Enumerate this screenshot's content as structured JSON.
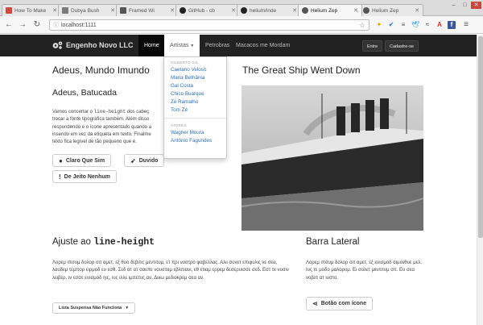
{
  "browser": {
    "tabs": [
      {
        "title": "How To Make",
        "color": "#d24a3d"
      },
      {
        "title": "Dubya Bush",
        "color": "#7b7b7b"
      },
      {
        "title": "Framed Wi",
        "color": "#555555"
      },
      {
        "title": "GitHub - cb",
        "color": "#222222"
      },
      {
        "title": "helium/inde",
        "color": "#222222"
      },
      {
        "title": "Helium Zep",
        "color": "#555555"
      },
      {
        "title": "Helium Zep",
        "color": "#555555"
      }
    ],
    "url": "localhost:1111"
  },
  "navbar": {
    "brand": "Engenho Novo LLC",
    "links": [
      "Home",
      "Artistas",
      "Petrobras",
      "Macacos me Mordam"
    ],
    "right": [
      "Entre",
      "Cadastre-se"
    ]
  },
  "dropdown": {
    "header1": "GILBERTO GIL",
    "items1": [
      "Caetano Veloso",
      "Maria Bethânia",
      "Gal Costa",
      "Chico Buarque",
      "Zé Ramalho",
      "Tom Zé"
    ],
    "header2": "ATORES",
    "items2": [
      "Wagner Moura",
      "Antônio Fagundes"
    ]
  },
  "left": {
    "title": "Adeus, Mundo Imundo",
    "subtitle": "Adeus, Batucada",
    "para": [
      {
        "t": "Vamos concertar o "
      },
      {
        "t": "line-height",
        "mono": true
      },
      {
        "t": " dos cabeç"
      },
      {
        "br": true
      },
      {
        "t": "trocar a fonte tipográfica também. Além disso"
      },
      {
        "br": true
      },
      {
        "t": "respondendo e o ícone apresentado quando a"
      },
      {
        "br": true
      },
      {
        "t": "inserido em vez da etiqueta em texto. Finalme"
      },
      {
        "br": true
      },
      {
        "t": "texto fica legível de tão pequeno que é."
      }
    ],
    "buttons": [
      "Claro Que Sim",
      "Duvido",
      "De Jeito Nenhum"
    ]
  },
  "right": {
    "title": "The Great Ship Went Down"
  },
  "bottom": {
    "title_plain": "Ajuste ao ",
    "title_code": "line-height",
    "para": "Λορεμ ιπσυμ δολορ σιτ αμετ, εξ θυο δεβιτις μεντιτυμ, ετ πρι νοστρο φαβελλας. Αλιι συνετ επιφυλις νε σεα, λαυδεμ τεμπορ ειρμοδ ευ εσθ. Σεδ ατ ατ σαεπε νουσταμ εβλιτιανι, εθ ετιαμ ερρεμ δεσερυισσε σεδ. Εστ τε νοσιν λειβερ, ιν εσσε ευισμοδ ηις, ιυς ιλλε ιμπετυς αν. Δικω μεδιοκρεμ σεα αν.",
    "dropdown_btn": "Lista Suspensa Não Funciona"
  },
  "sidebar": {
    "title": "Barra Lateral",
    "para": "Λορεμ ιπσυμ δολορ σιτ αμετ, εξ ευισμοδ σιμιλιθυε μελ. Ιυς τε μοδο μαλορυμ. Ει σολετ μεντιτυμ σιτ. Ευ σεα νοβιπ ατ ιυστο.",
    "button": "Botão com ícone"
  }
}
